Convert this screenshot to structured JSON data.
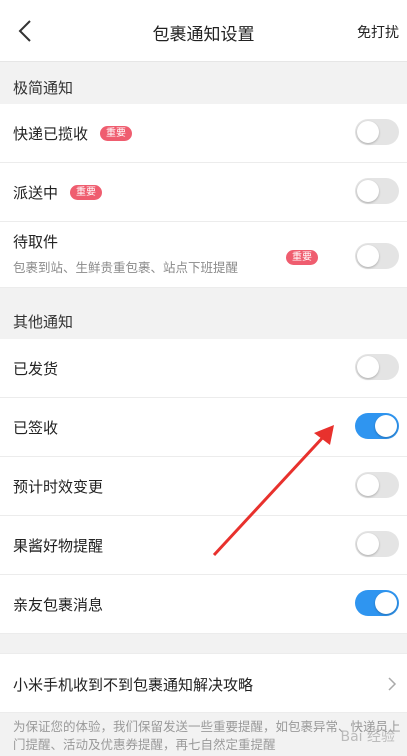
{
  "header": {
    "title": "包裹通知设置",
    "right_action": "免打扰"
  },
  "sections": [
    {
      "title": "极简通知",
      "items": [
        {
          "label": "快递已揽收",
          "tag": "重要",
          "on": false
        },
        {
          "label": "派送中",
          "tag": "重要",
          "on": false
        },
        {
          "label": "待取件",
          "sub": "包裹到站、生鲜贵重包裹、站点下班提醒",
          "tag": "重要",
          "on": false
        }
      ]
    },
    {
      "title": "其他通知",
      "items": [
        {
          "label": "已发货",
          "on": false
        },
        {
          "label": "已签收",
          "on": true
        },
        {
          "label": "预计时效变更",
          "on": false
        },
        {
          "label": "果酱好物提醒",
          "on": false
        },
        {
          "label": "亲友包裹消息",
          "on": true
        }
      ]
    }
  ],
  "link": {
    "label": "小米手机收到不到包裹通知解决攻略"
  },
  "footer_note": "为保证您的体验，我们保留发送一些重要提醒，如包裹异常、快递员上门提醒、活动及优惠券提醒，再七自然定重提醒",
  "watermark": "Bai 经验",
  "colors": {
    "toggle_on": "#2f95f0",
    "toggle_off": "#e4e4e4",
    "tag": "#ef5d6f",
    "annotation_arrow": "#e8312d"
  }
}
